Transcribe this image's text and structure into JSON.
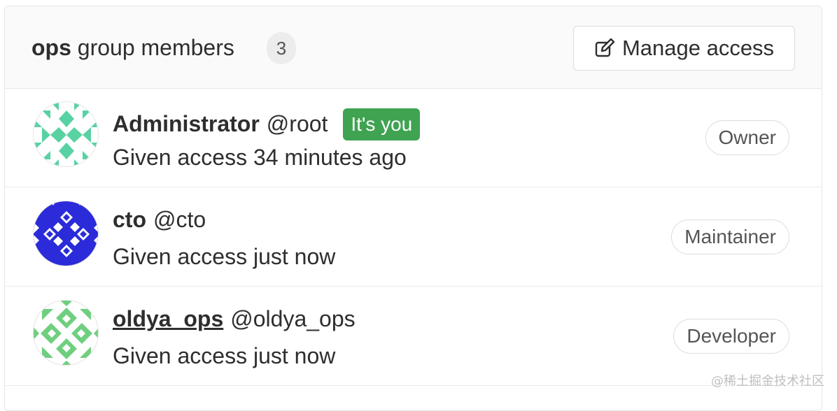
{
  "header": {
    "group_name": "ops",
    "title_suffix": " group members",
    "member_count": "3",
    "manage_access_label": "Manage access"
  },
  "members": [
    {
      "name": "Administrator",
      "username": "@root",
      "badge": "It's you",
      "access": "Given access 34 minutes ago",
      "role": "Owner",
      "avatar_color": "#59d2a3"
    },
    {
      "name": "cto",
      "username": "@cto",
      "access": "Given access just now",
      "role": "Maintainer",
      "avatar_color": "#2b2bd9"
    },
    {
      "name": "oldya_ops",
      "username": "@oldya_ops",
      "access": "Given access just now",
      "role": "Developer",
      "avatar_color": "#6fcf7f"
    }
  ],
  "watermark": "@稀土掘金技术社区",
  "colors": {
    "you_badge": "#3fa351",
    "header_bg": "#fafafa"
  }
}
